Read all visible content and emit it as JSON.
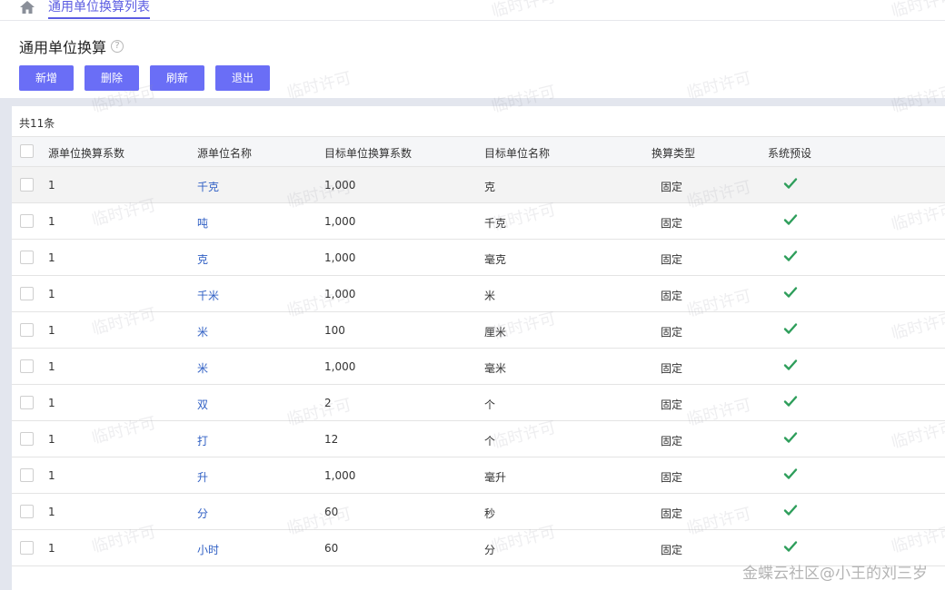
{
  "breadcrumb": {
    "tab_label": "通用单位换算列表"
  },
  "page": {
    "title": "通用单位换算"
  },
  "toolbar": {
    "add": "新增",
    "delete": "删除",
    "refresh": "刷新",
    "exit": "退出"
  },
  "summary": {
    "count_text": "共11条"
  },
  "table": {
    "headers": [
      "源单位换算系数",
      "源单位名称",
      "目标单位换算系数",
      "目标单位名称",
      "换算类型",
      "系统预设"
    ],
    "rows": [
      [
        "1",
        "千克",
        "1,000",
        "克",
        "固定"
      ],
      [
        "1",
        "吨",
        "1,000",
        "千克",
        "固定"
      ],
      [
        "1",
        "克",
        "1,000",
        "毫克",
        "固定"
      ],
      [
        "1",
        "千米",
        "1,000",
        "米",
        "固定"
      ],
      [
        "1",
        "米",
        "100",
        "厘米",
        "固定"
      ],
      [
        "1",
        "米",
        "1,000",
        "毫米",
        "固定"
      ],
      [
        "1",
        "双",
        "2",
        "个",
        "固定"
      ],
      [
        "1",
        "打",
        "12",
        "个",
        "固定"
      ],
      [
        "1",
        "升",
        "1,000",
        "毫升",
        "固定"
      ],
      [
        "1",
        "分",
        "60",
        "秒",
        "固定"
      ],
      [
        "1",
        "小时",
        "60",
        "分",
        "固定"
      ]
    ]
  },
  "watermark": {
    "text": "临时许可"
  },
  "footer": {
    "text": "金蝶云社区@小王的刘三岁"
  },
  "colors": {
    "accent": "#6a6ef6",
    "link": "#2f5fc4",
    "check": "#2e9e5b"
  }
}
